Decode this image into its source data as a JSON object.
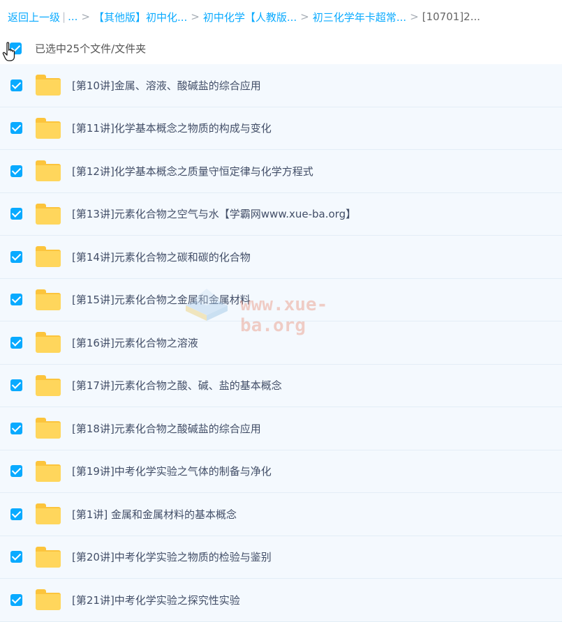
{
  "breadcrumb": {
    "back": "返回上一级",
    "ellipsis": "...",
    "items": [
      "【其他版】初中化...",
      "初中化学【人教版...",
      "初三化学年卡超常..."
    ],
    "current": "[10701]2..."
  },
  "selection": {
    "text": "已选中25个文件/文件夹",
    "checked": true
  },
  "files": [
    {
      "name": "[第10讲]金属、溶液、酸碱盐的综合应用",
      "type": "folder",
      "checked": true
    },
    {
      "name": "[第11讲]化学基本概念之物质的构成与变化",
      "type": "folder",
      "checked": true
    },
    {
      "name": "[第12讲]化学基本概念之质量守恒定律与化学方程式",
      "type": "folder",
      "checked": true
    },
    {
      "name": "[第13讲]元素化合物之空气与水【学霸网www.xue-ba.org】",
      "type": "folder",
      "checked": true
    },
    {
      "name": "[第14讲]元素化合物之碳和碳的化合物",
      "type": "folder",
      "checked": true
    },
    {
      "name": "[第15讲]元素化合物之金属和金属材料",
      "type": "folder",
      "checked": true
    },
    {
      "name": "[第16讲]元素化合物之溶液",
      "type": "folder",
      "checked": true
    },
    {
      "name": "[第17讲]元素化合物之酸、碱、盐的基本概念",
      "type": "folder",
      "checked": true
    },
    {
      "name": "[第18讲]元素化合物之酸碱盐的综合应用",
      "type": "folder",
      "checked": true
    },
    {
      "name": "[第19讲]中考化学实验之气体的制备与净化",
      "type": "folder",
      "checked": true
    },
    {
      "name": "[第1讲] 金属和金属材料的基本概念",
      "type": "folder",
      "checked": true
    },
    {
      "name": "[第20讲]中考化学实验之物质的检验与鉴别",
      "type": "folder",
      "checked": true
    },
    {
      "name": "[第21讲]中考化学实验之探究性实验",
      "type": "folder",
      "checked": true
    }
  ],
  "watermark": {
    "text": "www.xue-ba.org"
  },
  "colors": {
    "accent": "#09aaff",
    "folder": "#ffd65c",
    "row_bg": "#f4f9fe",
    "text": "#424e67"
  }
}
